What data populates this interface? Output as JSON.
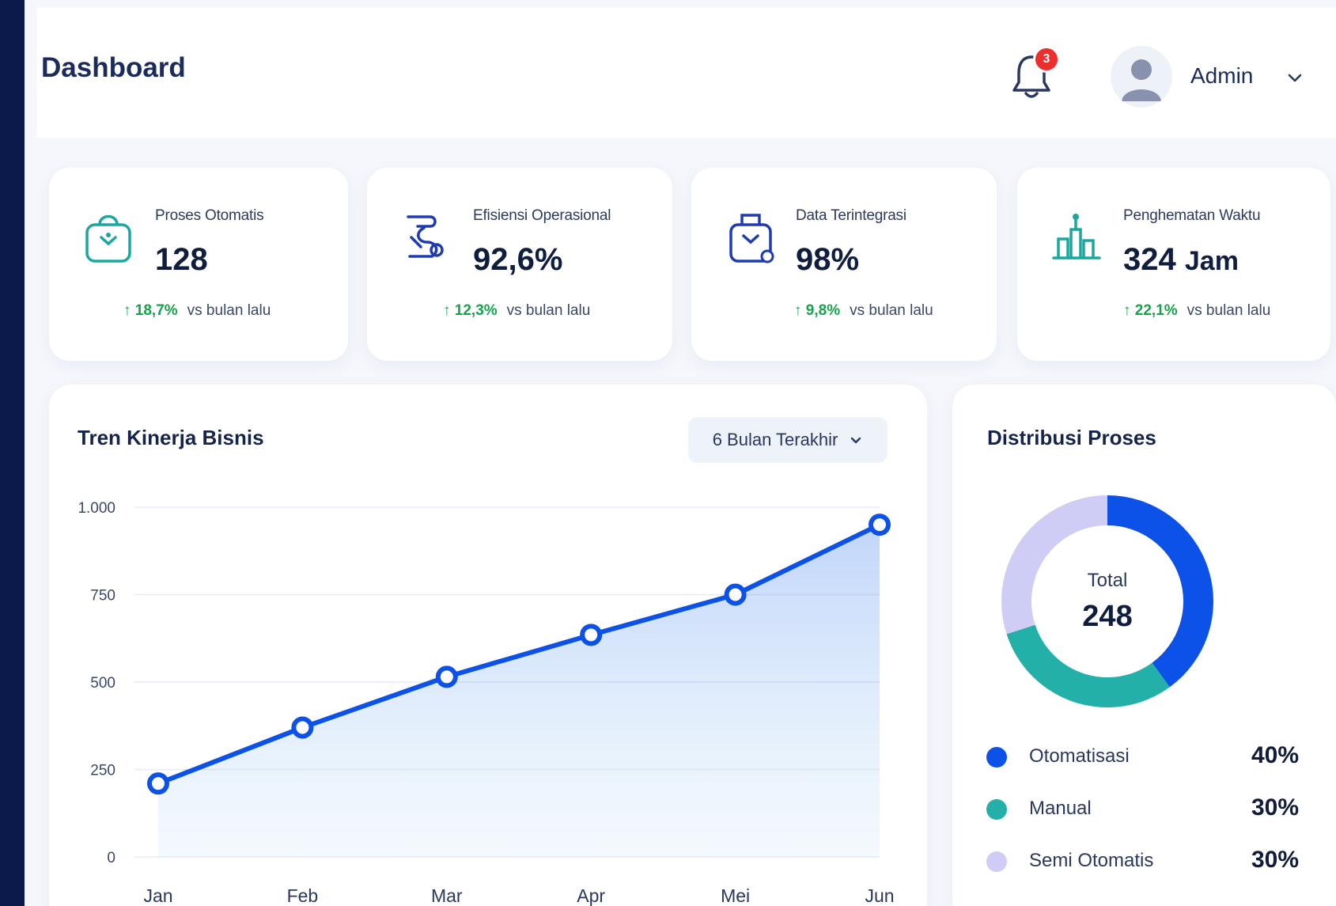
{
  "header": {
    "title": "Dashboard",
    "notification_count": "3",
    "user_name": "Admin"
  },
  "stats": [
    {
      "label": "Proses Otomatis",
      "value": "128",
      "unit": "",
      "trend": "18,7%",
      "trend_suffix": "vs bulan lalu",
      "icon": "bag-icon"
    },
    {
      "label": "Efisiensi Operasional",
      "value": "92,6%",
      "unit": "",
      "trend": "12,3%",
      "trend_suffix": "vs bulan lalu",
      "icon": "process-flow-icon"
    },
    {
      "label": "Data Terintegrasi",
      "value": "98%",
      "unit": "",
      "trend": "9,8%",
      "trend_suffix": "vs bulan lalu",
      "icon": "data-bag-icon"
    },
    {
      "label": "Penghematan Waktu",
      "value": "324",
      "unit": "Jam",
      "trend": "22,1%",
      "trend_suffix": "vs bulan lalu",
      "icon": "building-icon"
    }
  ],
  "trend_panel": {
    "title": "Tren Kinerja Bisnis",
    "range_label": "6 Bulan Terakhir"
  },
  "distribution_panel": {
    "title": "Distribusi Proses",
    "total_label": "Total",
    "total_value": "248",
    "legend": [
      {
        "label": "Otomatisasi",
        "pct": "40%",
        "color": "#0d52e8"
      },
      {
        "label": "Manual",
        "pct": "30%",
        "color": "#22b0a8"
      },
      {
        "label": "Semi Otomatis",
        "pct": "30%",
        "color": "#cfccf5"
      }
    ]
  },
  "chart_data": [
    {
      "type": "line",
      "title": "Tren Kinerja Bisnis",
      "categories": [
        "Jan",
        "Feb",
        "Mar",
        "Apr",
        "Mei",
        "Jun"
      ],
      "values": [
        210,
        370,
        515,
        635,
        750,
        950
      ],
      "ylim": [
        0,
        1000
      ],
      "yticks": [
        "0",
        "250",
        "500",
        "750",
        "1.000"
      ],
      "grid": true,
      "fill": "area-gradient",
      "color": "#0d52e8"
    },
    {
      "type": "pie",
      "title": "Distribusi Proses",
      "labels": [
        "Otomatisasi",
        "Manual",
        "Semi Otomatis"
      ],
      "values": [
        40,
        30,
        30
      ],
      "colors": [
        "#0d52e8",
        "#22b0a8",
        "#cfccf5"
      ]
    }
  ]
}
